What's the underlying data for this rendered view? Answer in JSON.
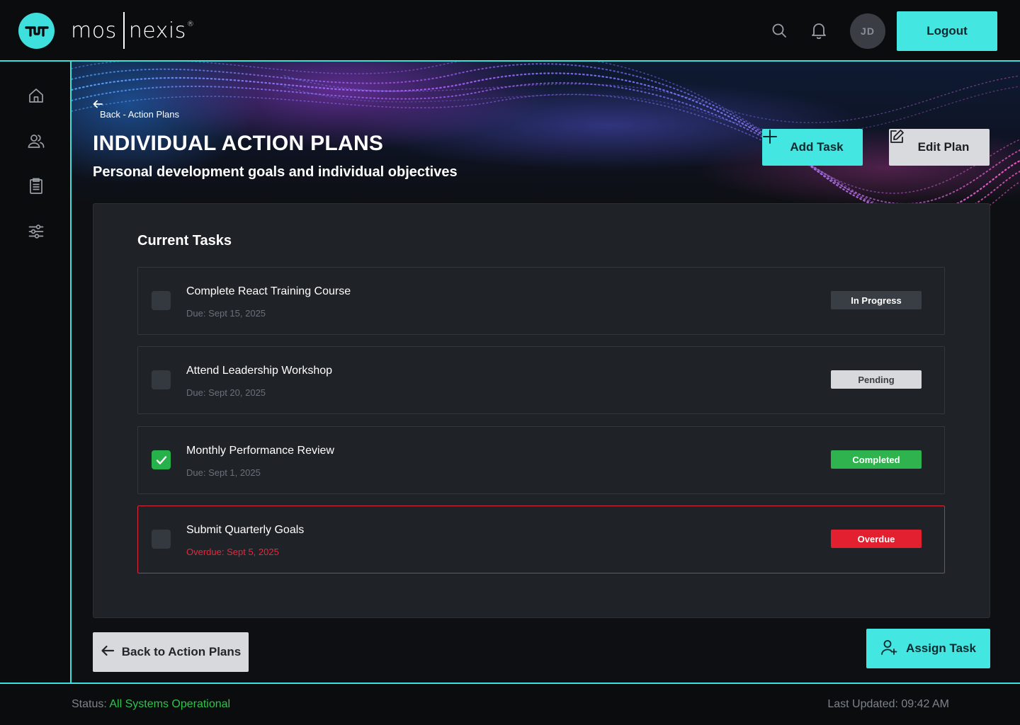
{
  "brand": {
    "name_left": "mos",
    "name_right": "nexis",
    "registered": "®",
    "accent": "#3de0dc"
  },
  "header": {
    "avatar_initials": "JD",
    "logout_label": "Logout",
    "icons": [
      "search-icon",
      "bell-icon"
    ]
  },
  "sidebar": {
    "items": [
      {
        "icon": "home-icon"
      },
      {
        "icon": "users-icon"
      },
      {
        "icon": "clipboard-icon"
      },
      {
        "icon": "sliders-icon"
      }
    ]
  },
  "hero": {
    "breadcrumb": "Back - Action Plans",
    "title": "INDIVIDUAL ACTION PLANS",
    "subtitle": "Personal development goals and individual objectives",
    "add_task_label": "Add Task",
    "edit_plan_label": "Edit Plan"
  },
  "tasks_panel": {
    "title": "Current Tasks",
    "tasks": [
      {
        "title": "Complete React Training Course",
        "due": "Due: Sept 15, 2025",
        "status": "In Progress",
        "checked": false
      },
      {
        "title": "Attend Leadership Workshop",
        "due": "Due: Sept 20, 2025",
        "status": "Pending",
        "checked": false
      },
      {
        "title": "Monthly Performance Review",
        "due": "Due: Sept 1, 2025",
        "status": "Completed",
        "checked": true
      },
      {
        "title": "Submit Quarterly Goals",
        "due": "Overdue: Sept 5, 2025",
        "status": "Overdue",
        "checked": false
      }
    ]
  },
  "actions": {
    "back_label": "Back to Action Plans",
    "assign_label": "Assign Task"
  },
  "footer": {
    "status_label": "Status:",
    "status_value": "All Systems Operational",
    "last_updated": "Last Updated: 09:42 AM"
  },
  "colors": {
    "accent": "#44e6e2",
    "completed": "#2fb34f",
    "overdue": "#e3202f",
    "pending": "#d7d9dd",
    "in_progress": "#393d44"
  }
}
